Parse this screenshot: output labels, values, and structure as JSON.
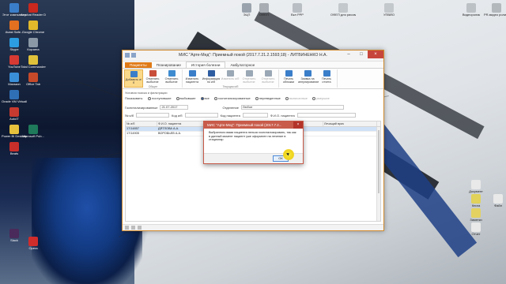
{
  "desktop": {
    "icons_left": [
      {
        "label": "Этот компьютер",
        "color": "#3a7ec9"
      },
      {
        "label": "Acrobat Reader DC",
        "color": "#c8281e"
      },
      {
        "label": "Avast Safe...",
        "color": "#e27020"
      },
      {
        "label": "Google Chrome",
        "color": "#e1b92b"
      },
      {
        "label": "Skype",
        "color": "#2c9de0"
      },
      {
        "label": "Корзина",
        "color": "#8b98a6"
      },
      {
        "label": "YouTube",
        "color": "#d73a33"
      },
      {
        "label": "Total Commander",
        "color": "#e0c23a"
      },
      {
        "label": "Магазин",
        "color": "#3a8fd9"
      },
      {
        "label": "Office Tab",
        "color": "#c64a2a"
      },
      {
        "label": "Oracle VM VirtualBox",
        "color": "#2f6fb6"
      },
      {
        "label": "AutoIT",
        "color": "#c73a2f"
      },
      {
        "label": "Power BI Desktop",
        "color": "#e6c13c"
      },
      {
        "label": "Microsoft Pub...",
        "color": "#1e7a5a"
      },
      {
        "label": "Beats",
        "color": "#c82f2a"
      },
      {
        "label": "Slack",
        "color": "#4a2a5a"
      },
      {
        "label": "Opera",
        "color": "#cf2c2c"
      }
    ],
    "icons_top": [
      {
        "label": "ЭЦП",
        "color": "#9aa3ad"
      },
      {
        "label": "ОФЕП",
        "color": "#a7adb3"
      },
      {
        "label": "Вкл РРР",
        "color": "#b8bec4"
      },
      {
        "label": "ОФЕП для рисования",
        "color": "#c3c8cc"
      },
      {
        "label": "УПВЙО",
        "color": "#c3c8cc"
      },
      {
        "label": "Видеоролик",
        "color": "#bcc1c5"
      },
      {
        "label": "PR-видео ролики",
        "color": "#b3b8bd"
      }
    ],
    "icons_right": [
      {
        "label": "Документ",
        "color": "#e9e9e9"
      },
      {
        "label": "Книга",
        "color": "#e0d25a"
      },
      {
        "label": "Файл",
        "color": "#e9e9e9"
      },
      {
        "label": "Заметки",
        "color": "#e3d262"
      },
      {
        "label": "Отчет",
        "color": "#e9e9e9"
      }
    ]
  },
  "window": {
    "title": "МИС \"Арте-Мед\": Приемный покой (2017.7.21.2.1593;18) - ЛИТВИНЕНКО Н.А.",
    "tabs": [
      "Пациенты",
      "Планирование",
      "История болезни",
      "Амбулаторное"
    ],
    "active_tab_index": 2,
    "ribbon": {
      "group1_label": "Общее",
      "group2_label": "Текущая и/б",
      "buttons": [
        {
          "label": "Добавить и/б",
          "icon_color": "#3a7ec9",
          "state": "selected"
        },
        {
          "label": "Отменить выбытие",
          "icon_color": "#c94e3a",
          "state": "normal"
        },
        {
          "label": "Отменить выбытие",
          "icon_color": "#3e8bd0",
          "state": "normal"
        },
        {
          "label": "Изменить пациента",
          "icon_color": "#3a7ec9",
          "state": "normal"
        },
        {
          "label": "Информация по и/б",
          "icon_color": "#2e5ca0",
          "state": "normal"
        },
        {
          "label": "Изменить и/б",
          "icon_color": "#9aa7b5",
          "state": "disabled"
        },
        {
          "label": "Отменить выбытие",
          "icon_color": "#9aa7b5",
          "state": "disabled"
        },
        {
          "label": "Отменить выбытие",
          "icon_color": "#9aa7b5",
          "state": "disabled"
        },
        {
          "label": "Печать обложки",
          "icon_color": "#3a7ec9",
          "state": "normal"
        },
        {
          "label": "Заявка на аннулирование",
          "icon_color": "#3a7ec9",
          "state": "normal"
        },
        {
          "label": "Печать отчета",
          "icon_color": "#3a7ec9",
          "state": "normal"
        }
      ]
    },
    "filter": {
      "caption": "Условия поиска и фильтрации",
      "show_label": "Показывать:",
      "options": [
        {
          "label": "поступившие",
          "on": false,
          "muted": false
        },
        {
          "label": "выбывшие",
          "on": false,
          "muted": false
        },
        {
          "label": "все",
          "on": true,
          "muted": false
        },
        {
          "label": "госпитализированные",
          "on": false,
          "muted": false
        },
        {
          "label": "переведенные",
          "on": false,
          "muted": false
        },
        {
          "label": "выписанные",
          "on": false,
          "muted": true
        },
        {
          "label": "умершие",
          "on": false,
          "muted": true
        }
      ]
    },
    "row2": {
      "hosp_label": "Госпитализированные",
      "date_value": "21.07.2017",
      "dept_label": "Отделение",
      "dept_value": "Любое"
    },
    "row3": {
      "nb_label": "№ и/б",
      "code_label": "Код и/б",
      "code_patient_label": "Код пациента",
      "fio_label": "Ф.И.О. пациента"
    },
    "grid": {
      "columns": [
        "№ и/б",
        "Ф.И.О. пациента",
        "",
        "",
        "",
        "Лечащий врач"
      ],
      "rows": [
        {
          "nb": "17/14857",
          "fio": "ДЯТЛОВА А.А.",
          "doctor": ""
        },
        {
          "nb": "17/14905",
          "fio": "ВОРОБЬЕВ А.А.",
          "doctor": ""
        }
      ]
    }
  },
  "dialog": {
    "title": "МИС \"Арте-Мед\": Приемный покой (2017.7.2...",
    "close": "×",
    "message": "Выбранного вами пациента нельзя госпитализировать, так как в данный момент пациент уже оформлен на лечение в стационар",
    "ok_label": "ОК"
  }
}
